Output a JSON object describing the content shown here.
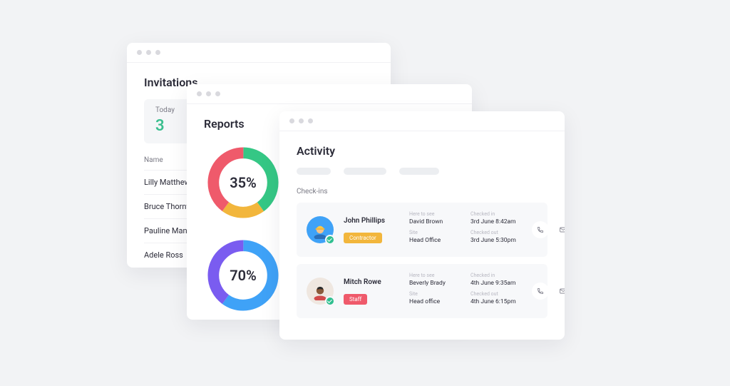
{
  "invitations": {
    "title": "Invitations",
    "today_label": "Today",
    "today_count": "3",
    "name_header": "Name",
    "rows": [
      "Lilly Matthews",
      "Bruce Thornton",
      "Pauline Mann",
      "Adele Ross"
    ]
  },
  "reports": {
    "title": "Reports",
    "charts": [
      {
        "label": "35%",
        "segments": [
          {
            "color": "#35c785",
            "pct": 40
          },
          {
            "color": "#f2b63c",
            "pct": 20
          },
          {
            "color": "#ef5a6b",
            "pct": 40
          }
        ]
      },
      {
        "label": "70%",
        "segments": [
          {
            "color": "#3fa2f7",
            "pct": 60
          },
          {
            "color": "#7a5cf0",
            "pct": 40
          }
        ]
      }
    ]
  },
  "activity": {
    "title": "Activity",
    "section": "Check-ins",
    "labels": {
      "here_to_see": "Here to see",
      "site": "Site",
      "checked_in": "Checked in",
      "checked_out": "Checked out"
    },
    "checkins": [
      {
        "name": "John Phillips",
        "role": "Contractor",
        "role_class": "contractor",
        "here_to_see": "David Brown",
        "site": "Head Office",
        "checked_in": "3rd June 8:42am",
        "checked_out": "3rd June 5:30pm"
      },
      {
        "name": "Mitch Rowe",
        "role": "Staff",
        "role_class": "staff",
        "here_to_see": "Beverly Brady",
        "site": "Head office",
        "checked_in": "4th June 9:35am",
        "checked_out": "4th June 6:15pm"
      }
    ]
  },
  "chart_data": [
    {
      "type": "pie",
      "title": "",
      "center_label": "35%",
      "series": [
        {
          "name": "green",
          "value": 40,
          "color": "#35c785"
        },
        {
          "name": "yellow",
          "value": 20,
          "color": "#f2b63c"
        },
        {
          "name": "red",
          "value": 40,
          "color": "#ef5a6b"
        }
      ]
    },
    {
      "type": "pie",
      "title": "",
      "center_label": "70%",
      "series": [
        {
          "name": "blue",
          "value": 60,
          "color": "#3fa2f7"
        },
        {
          "name": "purple",
          "value": 40,
          "color": "#7a5cf0"
        }
      ]
    }
  ]
}
